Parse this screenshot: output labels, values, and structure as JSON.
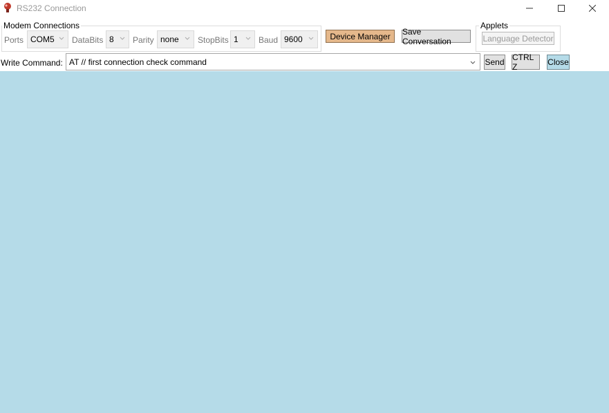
{
  "window": {
    "title": "RS232 Connection",
    "controls": [
      "minimize",
      "maximize",
      "close"
    ]
  },
  "modem": {
    "group_label": "Modem Connections",
    "ports_label": "Ports",
    "ports_value": "COM5",
    "databits_label": "DataBits",
    "databits_value": "8",
    "parity_label": "Parity",
    "parity_value": "none",
    "stopbits_label": "StopBits",
    "stopbits_value": "1",
    "baud_label": "Baud",
    "baud_value": "9600"
  },
  "toolbar": {
    "device_manager_label": "Device Manager",
    "save_conversation_label": "Save Conversation"
  },
  "applets": {
    "group_label": "Applets",
    "language_detector_label": "Language Detector"
  },
  "command": {
    "label": "Write Command:",
    "value": "AT // first connection check command",
    "send_label": "Send",
    "ctrlz_label": "CTRL Z",
    "close_label": "Close"
  },
  "colors": {
    "output_background": "#b5dbe8",
    "device_manager_button": "#e5b88b",
    "close_button": "#b5dbe8"
  }
}
